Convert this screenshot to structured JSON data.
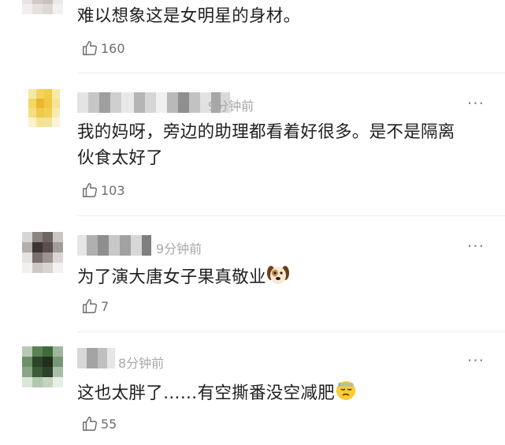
{
  "comments": [
    {
      "text": "难以想象这是女明星的身材。",
      "likes": "160"
    },
    {
      "time": "9分钟前",
      "text_line1": "我的妈呀，旁边的助理都看着好很多。是不是隔离",
      "text_line2": "伙食太好了",
      "likes": "103"
    },
    {
      "time": "9分钟前",
      "text": "为了演大唐女子果真敬业",
      "emoji": "dog-face-emoji",
      "likes": "7"
    },
    {
      "time": "8分钟前",
      "text": "这也太胖了……有空撕番没空减肥",
      "emoji": "downcast-face-with-sweat-emoji",
      "likes": "55"
    }
  ],
  "more_icon": "···",
  "icons": {
    "like": "thumbs-up-outline-icon",
    "more": "more-dots-icon"
  },
  "colors": {
    "text": "#1f1f1f",
    "muted": "#a8a8a8",
    "like": "#6e6e6e",
    "divider": "#ececec"
  }
}
